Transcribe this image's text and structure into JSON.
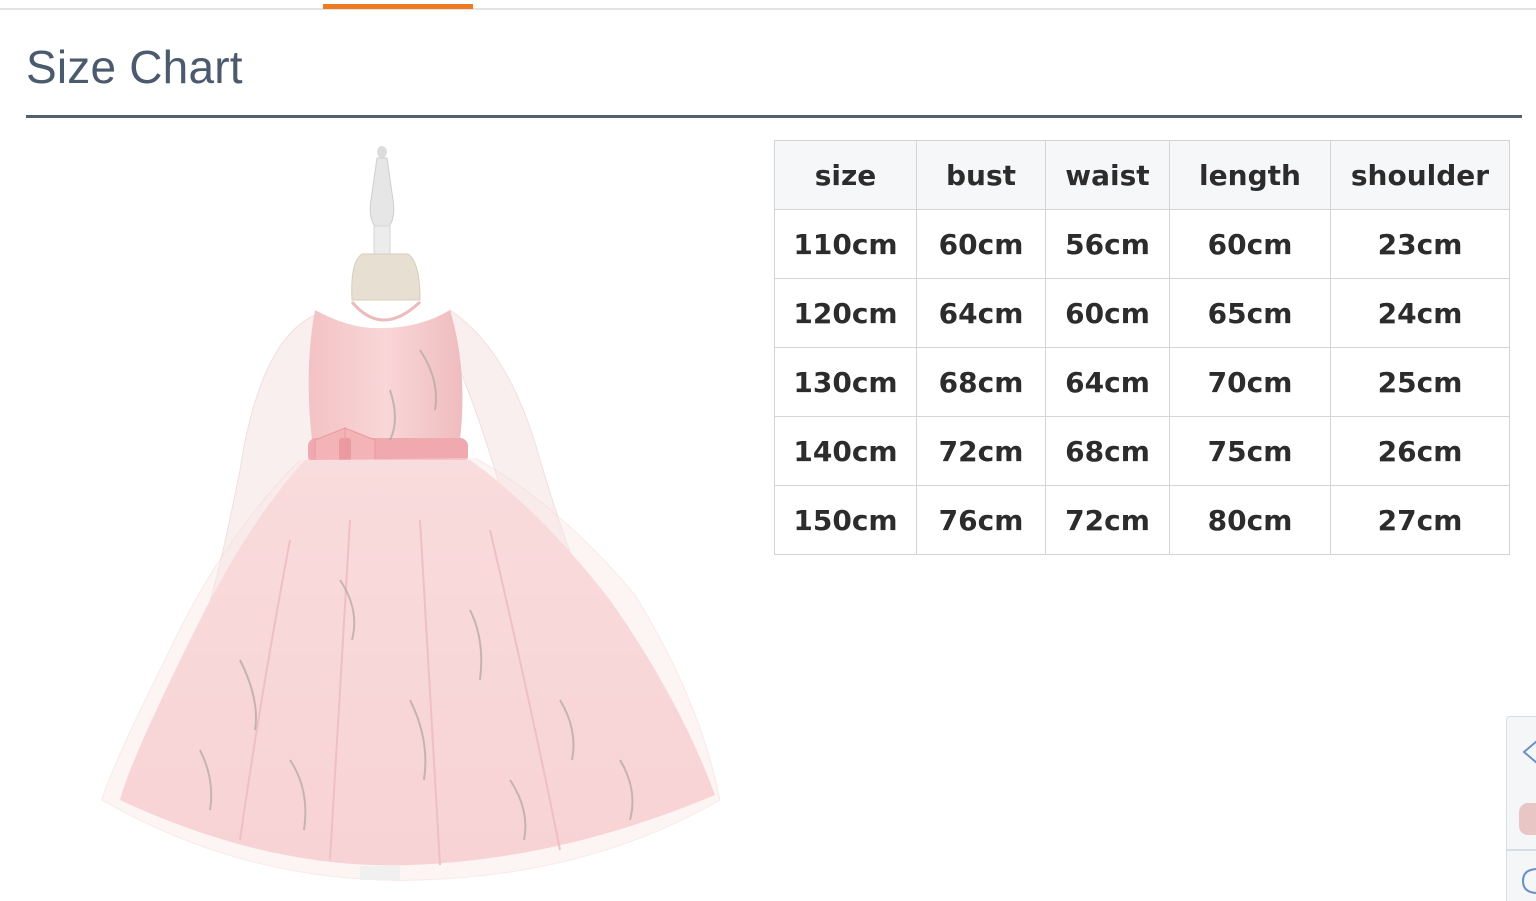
{
  "section": {
    "title": "Size Chart"
  },
  "colors": {
    "accent": "#f07a22",
    "title": "#4b5a6d",
    "rule": "#55606e",
    "dress_pink": "#f6c9cb"
  },
  "size_table": {
    "headers": [
      "size",
      "bust",
      "waist",
      "length",
      "shoulder"
    ],
    "rows": [
      [
        "110cm",
        "60cm",
        "56cm",
        "60cm",
        "23cm"
      ],
      [
        "120cm",
        "64cm",
        "60cm",
        "65cm",
        "24cm"
      ],
      [
        "130cm",
        "68cm",
        "64cm",
        "70cm",
        "25cm"
      ],
      [
        "140cm",
        "72cm",
        "68cm",
        "75cm",
        "26cm"
      ],
      [
        "150cm",
        "76cm",
        "72cm",
        "80cm",
        "27cm"
      ]
    ]
  },
  "product_image": {
    "icon": "dress-photo"
  },
  "side_widget": {
    "icons": [
      "share-icon",
      "product-thumbnail",
      "chat-icon"
    ]
  }
}
